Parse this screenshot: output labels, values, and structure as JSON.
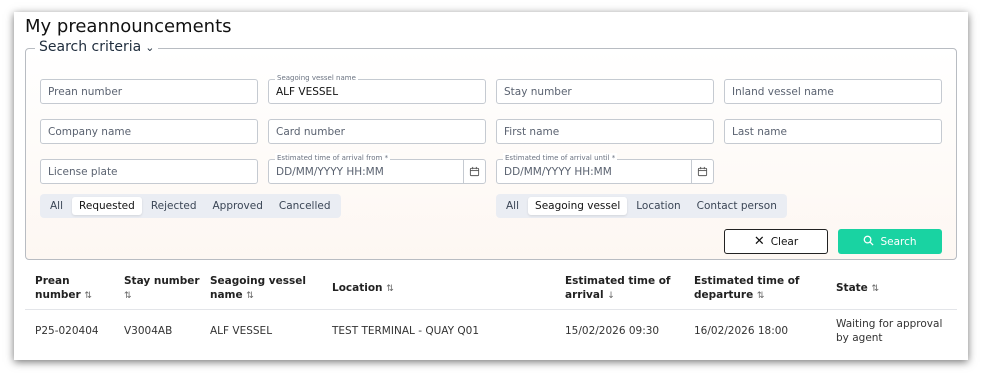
{
  "page": {
    "title": "My preannouncements"
  },
  "search": {
    "legend": "Search criteria",
    "fields": {
      "prean_number": {
        "placeholder": "Prean number"
      },
      "seagoing_vessel": {
        "label": "Seagoing vessel name",
        "value": "ALF VESSEL"
      },
      "stay_number": {
        "placeholder": "Stay number"
      },
      "inland_vessel": {
        "placeholder": "Inland vessel name"
      },
      "company_name": {
        "placeholder": "Company name"
      },
      "card_number": {
        "placeholder": "Card number"
      },
      "first_name": {
        "placeholder": "First name"
      },
      "last_name": {
        "placeholder": "Last name"
      },
      "license_plate": {
        "placeholder": "License plate"
      },
      "eta_from": {
        "label": "Estimated time of arrival from *",
        "placeholder": "DD/MM/YYYY HH:MM"
      },
      "eta_until": {
        "label": "Estimated time of arrival until *",
        "placeholder": "DD/MM/YYYY HH:MM"
      }
    },
    "status_filter": {
      "options": [
        "All",
        "Requested",
        "Rejected",
        "Approved",
        "Cancelled"
      ],
      "selected": "Requested"
    },
    "type_filter": {
      "options": [
        "All",
        "Seagoing vessel",
        "Location",
        "Contact person"
      ],
      "selected": "Seagoing vessel"
    },
    "clear_label": "Clear",
    "search_label": "Search"
  },
  "table": {
    "headers": {
      "prean": [
        "Prean",
        "number"
      ],
      "stay": [
        "Stay number",
        ""
      ],
      "vessel": [
        "Seagoing vessel",
        "name"
      ],
      "location": "Location",
      "arrival": [
        "Estimated time of",
        "arrival"
      ],
      "departure": [
        "Estimated time of",
        "departure"
      ],
      "state": "State"
    },
    "rows": [
      {
        "prean": "P25-020404",
        "stay": "V3004AB",
        "vessel": "ALF VESSEL",
        "location": "TEST TERMINAL - QUAY Q01",
        "arrival": "15/02/2026 09:30",
        "departure": "16/02/2026 18:00",
        "state": [
          "Waiting for approval",
          "by agent"
        ]
      }
    ]
  },
  "colors": {
    "accent": "#19d3a2",
    "panel_bg": "#fdf7f2"
  }
}
